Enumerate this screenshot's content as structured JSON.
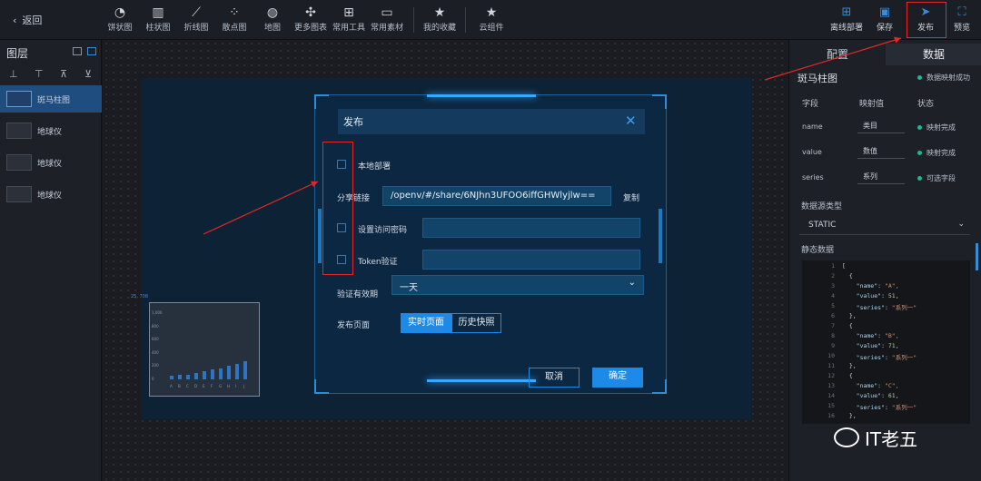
{
  "header": {
    "back_label": "返回",
    "tools": [
      {
        "label": "饼状图",
        "icon": "pie-chart-icon"
      },
      {
        "label": "柱状图",
        "icon": "bar-chart-icon"
      },
      {
        "label": "折线图",
        "icon": "line-chart-icon"
      },
      {
        "label": "散点图",
        "icon": "scatter-chart-icon"
      },
      {
        "label": "地图",
        "icon": "globe-icon"
      },
      {
        "label": "更多图表",
        "icon": "more-charts-icon"
      },
      {
        "label": "常用工具",
        "icon": "tools-grid-icon"
      },
      {
        "label": "常用素材",
        "icon": "folder-icon"
      },
      {
        "label": "我的收藏",
        "icon": "star-icon"
      },
      {
        "label": "云组件",
        "icon": "star-icon"
      }
    ],
    "right_tools": [
      {
        "label": "离线部署",
        "icon": "grid-icon"
      },
      {
        "label": "保存",
        "icon": "save-icon"
      },
      {
        "label": "发布",
        "icon": "send-icon"
      },
      {
        "label": "预览",
        "icon": "fullscreen-icon"
      }
    ]
  },
  "layers": {
    "title": "图层",
    "items": [
      {
        "label": "斑马柱图"
      },
      {
        "label": "地球仪"
      },
      {
        "label": "地球仪"
      },
      {
        "label": "地球仪"
      }
    ]
  },
  "chart_preview": {
    "caption": "25, 708",
    "categories": [
      "A",
      "B",
      "C",
      "D",
      "E",
      "F",
      "G",
      "H",
      "I",
      "J"
    ],
    "values": [
      51,
      71,
      61,
      90,
      120,
      140,
      160,
      200,
      220,
      260
    ],
    "y_labels": [
      "1,000",
      "800",
      "600",
      "400",
      "200",
      "0"
    ]
  },
  "panel": {
    "tab_config": "配置",
    "tab_data": "数据",
    "component_name": "斑马柱图",
    "map_status": "数据映射成功",
    "col_field": "字段",
    "col_map": "映射值",
    "col_status": "状态",
    "rows": [
      {
        "field": "name",
        "value": "类目",
        "status": "映射完成"
      },
      {
        "field": "value",
        "value": "数值",
        "status": "映射完成"
      },
      {
        "field": "series",
        "value": "系列",
        "status": "可选字段"
      }
    ],
    "source_type_label": "数据源类型",
    "source_type_value": "STATIC",
    "static_label": "静态数据"
  },
  "code_lines": [
    {
      "n": "1",
      "t": "["
    },
    {
      "n": "2",
      "t": "  {"
    },
    {
      "n": "3",
      "k": "\"name\"",
      "v": "\"A\","
    },
    {
      "n": "4",
      "k": "\"value\"",
      "v": "51,"
    },
    {
      "n": "5",
      "k": "\"series\"",
      "v": "\"系列一\""
    },
    {
      "n": "6",
      "t": "  },"
    },
    {
      "n": "7",
      "t": "  {"
    },
    {
      "n": "8",
      "k": "\"name\"",
      "v": "\"B\","
    },
    {
      "n": "9",
      "k": "\"value\"",
      "v": "71,"
    },
    {
      "n": "10",
      "k": "\"series\"",
      "v": "\"系列一\""
    },
    {
      "n": "11",
      "t": "  },"
    },
    {
      "n": "12",
      "t": "  {"
    },
    {
      "n": "13",
      "k": "\"name\"",
      "v": "\"C\","
    },
    {
      "n": "14",
      "k": "\"value\"",
      "v": "61,"
    },
    {
      "n": "15",
      "k": "\"series\"",
      "v": "\"系列一\""
    },
    {
      "n": "16",
      "t": "  },"
    }
  ],
  "watermark": "IT老五",
  "modal": {
    "title": "发布",
    "local_deploy": "本地部署",
    "share_link_label": "分享链接",
    "share_link_value": "/openv/#/share/6NJhn3UFOO6iffGHWlyjlw==",
    "copy_label": "复制",
    "password_label": "设置访问密码",
    "token_label": "Token验证",
    "validity_label": "验证有效期",
    "validity_value": "一天",
    "publish_page_label": "发布页面",
    "tab_live": "实时页面",
    "tab_history": "历史快照",
    "cancel_label": "取消",
    "confirm_label": "确定"
  }
}
